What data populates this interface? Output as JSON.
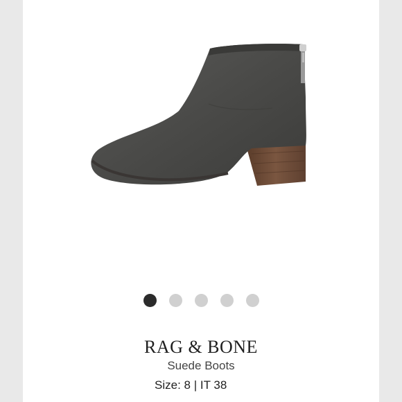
{
  "product": {
    "brand": "RAG & BONE",
    "name": "Suede Boots",
    "size_label": "Size:",
    "size_value": "8 | IT 38",
    "image_icon": "ankle-boot-icon"
  },
  "carousel": {
    "count": 5,
    "active_index": 0,
    "dots": [
      "1",
      "2",
      "3",
      "4",
      "5"
    ]
  },
  "colors": {
    "suede": "#4a4a48",
    "heel": "#6b4a35",
    "dot_active": "#2b2b2b",
    "dot_inactive": "#d0d0d0"
  }
}
